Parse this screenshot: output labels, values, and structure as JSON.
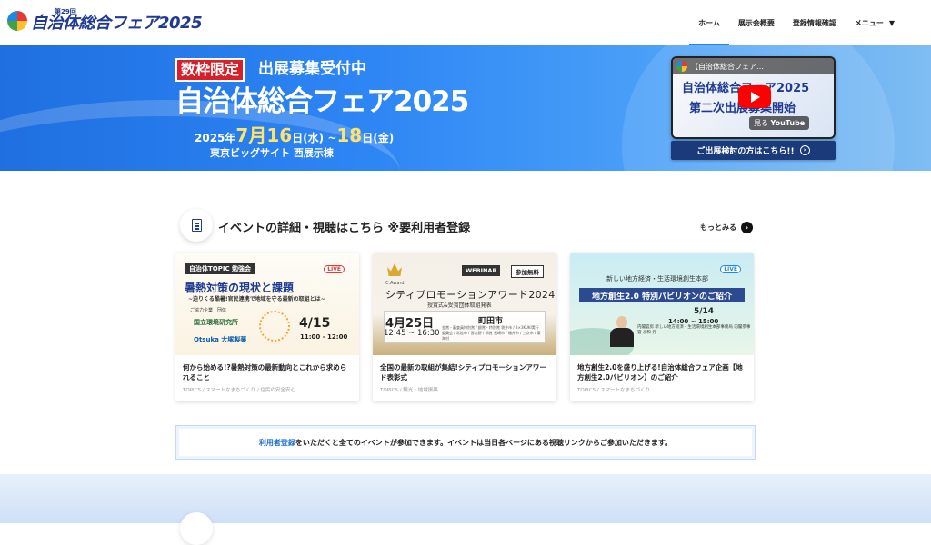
{
  "header": {
    "logo_sub": "第29回",
    "logo_main": "自治体総合フェア2025",
    "nav": [
      "ホーム",
      "展示会概要",
      "登録情報確認",
      "メニュー"
    ]
  },
  "hero": {
    "badge": "数枠限定",
    "recruit": "出展募集受付中",
    "title": "自治体総合フェア2025",
    "date_year": "2025年",
    "date_m1": "7月",
    "date_d1": "16",
    "date_w1": "日(水) ~",
    "date_d2": "18",
    "date_w2": "日(金)",
    "venue": "東京ビッグサイト 西展示棟",
    "video_title": "【自治体総合フェア…",
    "video_line1": "自治体総合フェア2025",
    "video_line2": "第二次出展募集開始",
    "video_watch": "見る",
    "video_brand": "YouTube",
    "consider_button": "ご出展検討の方はこちら!!"
  },
  "section": {
    "title": "イベントの詳細・視聴はこちら ※要利用者登録",
    "more": "もっとみる"
  },
  "cards": [
    {
      "img": {
        "label": "自治体TOPIC 勉強会",
        "live": "LIVE",
        "title": "暑熱対策の現状と課題",
        "sub": "~迫りくる酷暑!官民連携で地域を守る最新の取組とは~",
        "coop": "ご協力企業・団体",
        "org1": "国立環境研究所",
        "org2": "Otsuka 大塚製薬",
        "date": "4/15",
        "time": "11:00 - 12:00"
      },
      "title": "何から始める!?暑熱対策の最新動向とこれから求められること",
      "tags": "TOPICS / スマートなまちづくり / 住民の安全安心"
    },
    {
      "img": {
        "webinar": "WEBINAR",
        "free": "参加無料",
        "award": "C.Award",
        "title": "シティプロモーションアワード2024",
        "sub": "授賞式&受賞団体取組発表",
        "date": "4月25日",
        "time": "12:45 ~ 16:30",
        "city": "町田市",
        "detail": "金賞・審査員特別賞 / 銀賞・特別賞 袋井市 / 3×3KUKI実行委員会 / 常陸市 / 習志野 / 銅賞 長崎市 / 福井市 / 三次市 / 東海村"
      },
      "title": "全国の最新の取組が集結!シティプロモーションアワード表彰式",
      "tags": "TOPICS / 観光・地域振興"
    },
    {
      "img": {
        "live": "LIVE",
        "top": "新しい地方経済・生活環境創生本部",
        "band": "地方創生2.0 特別パビリオンのご紹介",
        "date": "5/14",
        "time": "14:00 ~ 15:00",
        "role": "内閣官房 新しい地方経済・生活環境創生本部事務局 内閣参事官 永和 元"
      },
      "title": "地方創生2.0を盛り上げる!自治体総合フェア企画【地方創生2.0パビリオン】のご紹介",
      "tags": "TOPICS / スマートなまちづくり"
    }
  ],
  "notice": {
    "link": "利用者登録",
    "text": "をいただくと全てのイベントが参加できます。イベントは当日各ページにある視聴リンクからご参加いただきます。"
  },
  "colors": {
    "brand": "#1f3a93",
    "accent": "#1e88e5",
    "badge_red": "#d8202a"
  }
}
